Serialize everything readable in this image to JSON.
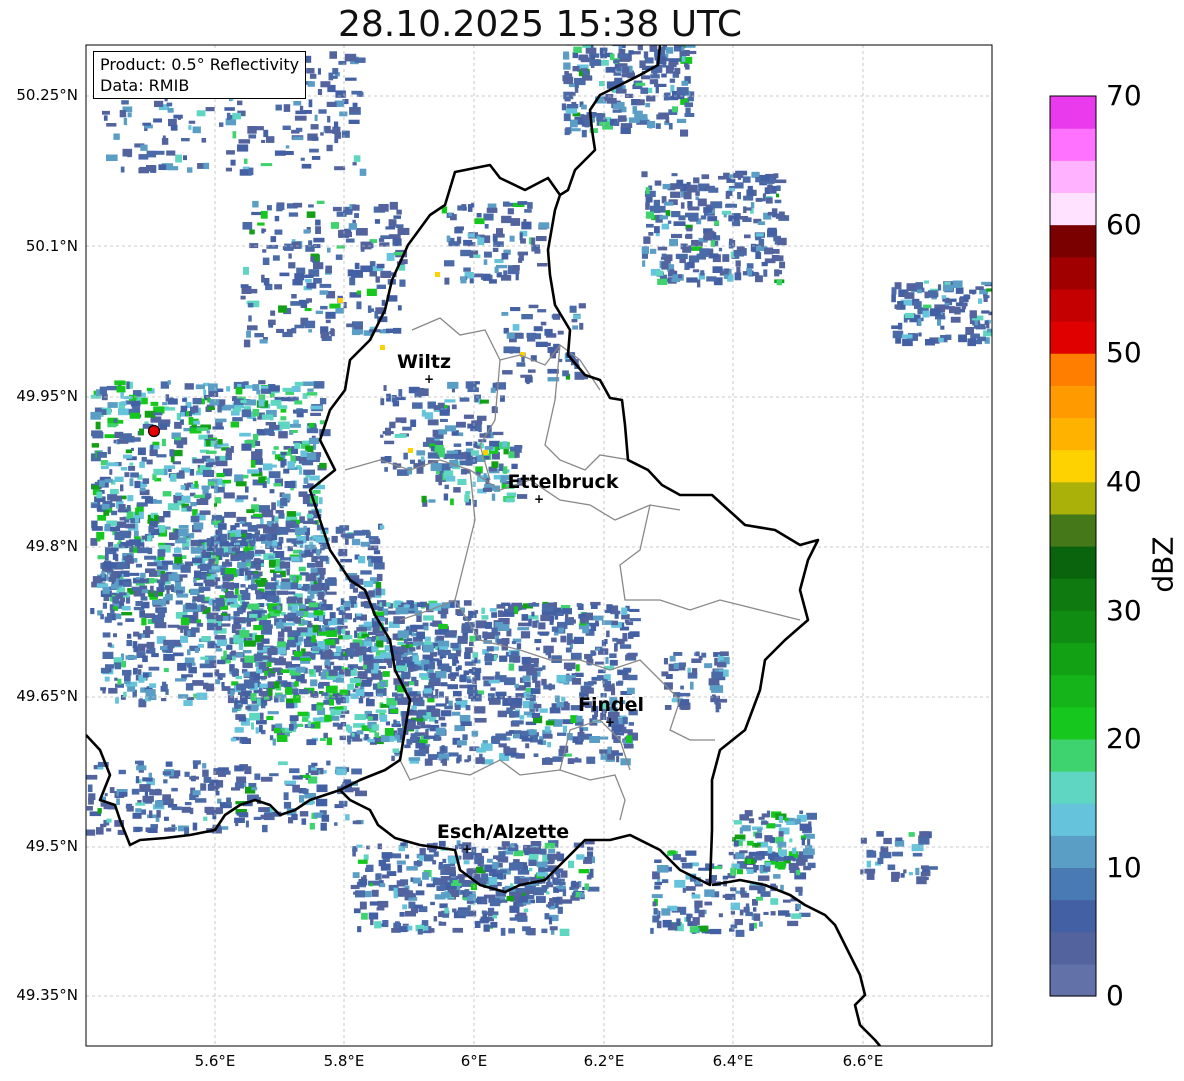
{
  "title": "28.10.2025 15:38 UTC",
  "info_box": {
    "product": "Product: 0.5° Reflectivity",
    "data": "Data: RMIB"
  },
  "axes": {
    "lat_ticks": [
      "50.25°N",
      "50.1°N",
      "49.95°N",
      "49.8°N",
      "49.65°N",
      "49.5°N",
      "49.35°N"
    ],
    "lon_ticks": [
      "5.6°E",
      "5.8°E",
      "6°E",
      "6.2°E",
      "6.4°E",
      "6.6°E"
    ]
  },
  "cities": [
    {
      "name": "Wiltz"
    },
    {
      "name": "Ettelbruck"
    },
    {
      "name": "Findel"
    },
    {
      "name": "Esch/Alzette"
    }
  ],
  "colorbar": {
    "label": "dBZ",
    "ticks": [
      "0",
      "10",
      "20",
      "30",
      "40",
      "50",
      "60",
      "70"
    ],
    "colors": [
      "#6272a8",
      "#52639e",
      "#4460a4",
      "#4a7ab4",
      "#5a9ec6",
      "#66c3dc",
      "#5ed6c2",
      "#3ed36e",
      "#16c81e",
      "#14b41a",
      "#12a114",
      "#108c12",
      "#0e7a10",
      "#0a640e",
      "#447818",
      "#aab20a",
      "#fed200",
      "#ffb200",
      "#ff9a00",
      "#ff7e00",
      "#e00000",
      "#c40000",
      "#a00000",
      "#7a0000",
      "#ffe2ff",
      "#ffb2ff",
      "#ff72ff",
      "#ea3aee"
    ]
  }
}
